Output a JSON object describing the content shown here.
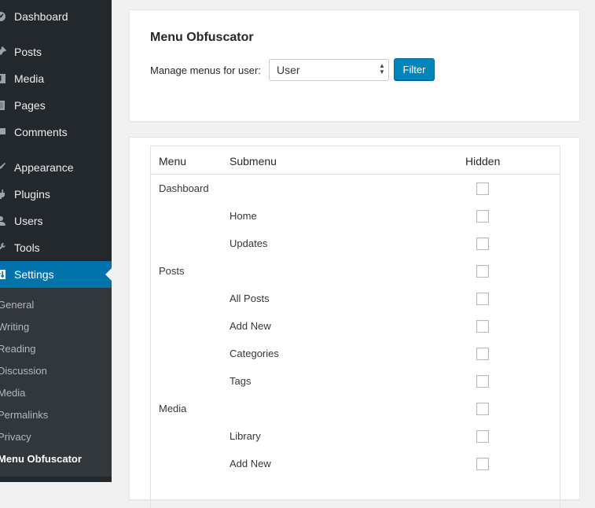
{
  "sidebar": {
    "items": [
      {
        "label": "Dashboard",
        "icon": "dashboard-icon"
      },
      {
        "label": "Posts",
        "icon": "pushpin-icon"
      },
      {
        "label": "Media",
        "icon": "media-icon"
      },
      {
        "label": "Pages",
        "icon": "pages-icon"
      },
      {
        "label": "Comments",
        "icon": "comments-icon"
      },
      {
        "label": "Appearance",
        "icon": "paintbrush-icon"
      },
      {
        "label": "Plugins",
        "icon": "plugins-icon"
      },
      {
        "label": "Users",
        "icon": "users-icon"
      },
      {
        "label": "Tools",
        "icon": "wrench-icon"
      },
      {
        "label": "Settings",
        "icon": "settings-icon"
      }
    ],
    "submenu": [
      "General",
      "Writing",
      "Reading",
      "Discussion",
      "Media",
      "Permalinks",
      "Privacy",
      "Menu Obfuscator"
    ]
  },
  "main": {
    "title": "Menu Obfuscator",
    "filter_label": "Manage menus for user:",
    "select_value": "User",
    "filter_button": "Filter",
    "table": {
      "headers": {
        "menu": "Menu",
        "submenu": "Submenu",
        "hidden": "Hidden"
      },
      "rows": [
        {
          "menu": "Dashboard",
          "submenu": "",
          "hidden": false
        },
        {
          "menu": "",
          "submenu": "Home",
          "hidden": false
        },
        {
          "menu": "",
          "submenu": "Updates",
          "hidden": false
        },
        {
          "menu": "Posts",
          "submenu": "",
          "hidden": false
        },
        {
          "menu": "",
          "submenu": "All Posts",
          "hidden": false
        },
        {
          "menu": "",
          "submenu": "Add New",
          "hidden": false
        },
        {
          "menu": "",
          "submenu": "Categories",
          "hidden": false
        },
        {
          "menu": "",
          "submenu": "Tags",
          "hidden": false
        },
        {
          "menu": "Media",
          "submenu": "",
          "hidden": false
        },
        {
          "menu": "",
          "submenu": "Library",
          "hidden": false
        },
        {
          "menu": "",
          "submenu": "Add New",
          "hidden": false
        }
      ]
    }
  },
  "colors": {
    "sidebar_bg": "#23282d",
    "submenu_bg": "#32373c",
    "accent": "#0073aa",
    "button": "#0085ba"
  }
}
